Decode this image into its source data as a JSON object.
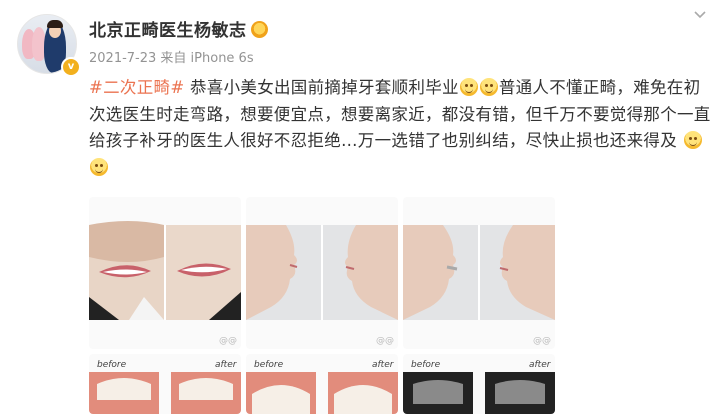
{
  "post": {
    "author": "北京正畸医生杨敏志",
    "meta": "2021-7-23  来自 iPhone 6s",
    "hashtag": "#二次正畸#",
    "text_part1": " 恭喜小美女出国前摘掉牙套顺利毕业",
    "text_part2": "普通人不懂正畸，难免在初次选医生时走弯路，想要便宜点，想要离家近，都没有错，但千万不要觉得那个一直给孩子补牙的医生人很好不忍拒绝…万一选错了也别纠结，尽快止损也还来得及"
  },
  "images": {
    "watermark": "@@",
    "before_label": "before",
    "after_label": "after"
  },
  "icons": {
    "more": "chevron-down-icon",
    "verified": "verified-icon",
    "emoji": "smile-emoji-icon",
    "badge": "fan-badge-icon"
  },
  "colors": {
    "hashtag": "#eb7350",
    "meta": "#939393",
    "text": "#333333"
  }
}
